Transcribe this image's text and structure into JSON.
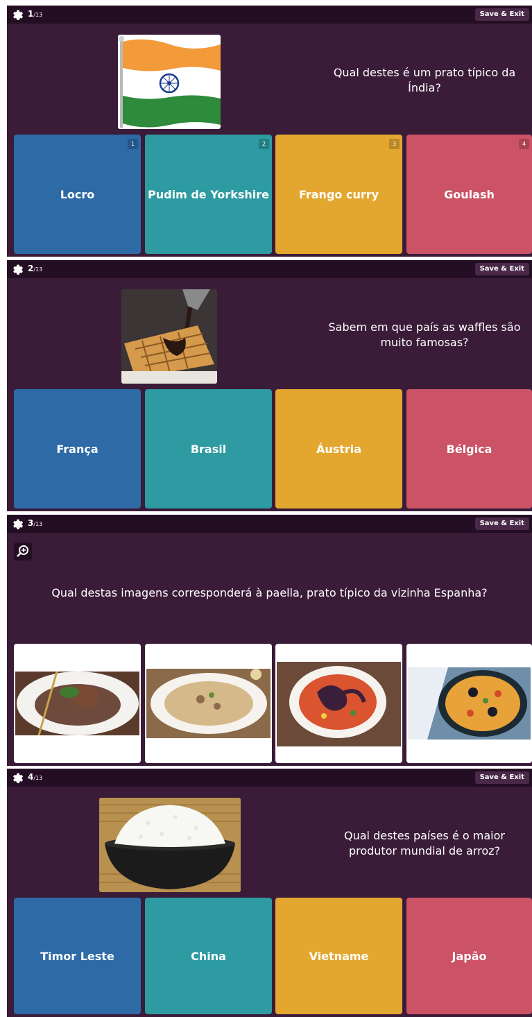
{
  "save_label": "Save & Exit",
  "questions": [
    {
      "number": "1",
      "total": "/13",
      "text": "Qual destes é um prato típico da Índia?",
      "image": "india-flag",
      "options": [
        {
          "label": "Locro",
          "key": "1",
          "color": "#2d6aa6"
        },
        {
          "label": "Pudim de Yorkshire",
          "key": "2",
          "color": "#2e9aa1"
        },
        {
          "label": "Frango curry",
          "key": "3",
          "color": "#e3a72f"
        },
        {
          "label": "Goulash",
          "key": "4",
          "color": "#cc5266"
        }
      ]
    },
    {
      "number": "2",
      "total": "/13",
      "text": "Sabem em que país as waffles são muito famosas?",
      "image": "waffle-photo",
      "options": [
        {
          "label": "França"
        },
        {
          "label": "Brasil"
        },
        {
          "label": "Áustria"
        },
        {
          "label": "Bélgica"
        }
      ]
    },
    {
      "number": "3",
      "total": "/13",
      "text": "Qual destas imagens corresponderá à paella, prato típico da vizinha Espanha?",
      "options": [
        {
          "image": "meat-rice-photo"
        },
        {
          "image": "risotto-photo"
        },
        {
          "image": "octopus-rice-photo"
        },
        {
          "image": "paella-photo"
        }
      ]
    },
    {
      "number": "4",
      "total": "/13",
      "text": "Qual destes países é o maior produtor mundial de arroz?",
      "image": "rice-bowl-photo",
      "options": [
        {
          "label": "Timor Leste"
        },
        {
          "label": "China"
        },
        {
          "label": "Vietname"
        },
        {
          "label": "Japão"
        }
      ]
    }
  ]
}
